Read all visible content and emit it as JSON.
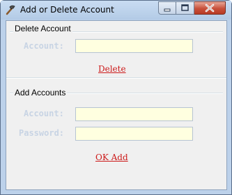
{
  "window": {
    "title": "Add or Delete Account",
    "controls": {
      "minimize_icon": "minimize-icon",
      "maximize_icon": "maximize-icon",
      "close_icon": "close-icon"
    }
  },
  "delete_section": {
    "heading": "Delete Account",
    "account_label": "Account:",
    "account_value": "",
    "delete_link": "Delete"
  },
  "add_section": {
    "heading": "Add Accounts",
    "account_label": "Account:",
    "account_value": "",
    "password_label": "Password:",
    "password_value": "",
    "ok_link": "OK Add"
  },
  "colors": {
    "link": "#cc1a1a",
    "field_label": "#c8d4e4",
    "input_bg": "#ffffe0",
    "frame": "#bcd1ea"
  }
}
